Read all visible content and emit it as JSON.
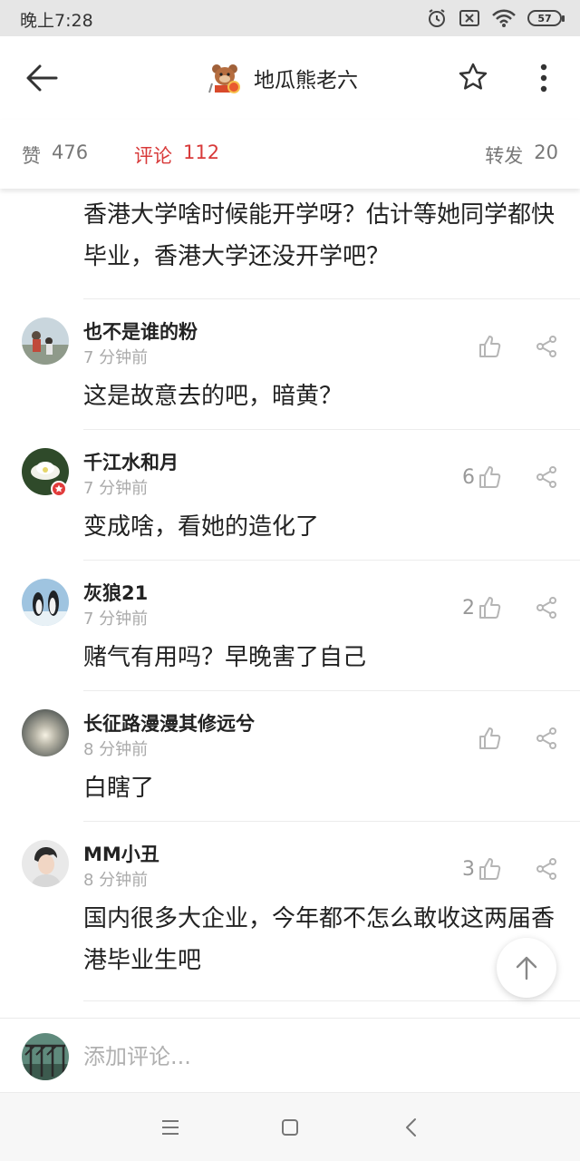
{
  "status_bar": {
    "time": "晚上7:28",
    "battery": "57"
  },
  "header": {
    "title": "地瓜熊老六"
  },
  "tabs": {
    "like_label": "赞",
    "like_count": "476",
    "comment_label": "评论",
    "comment_count": "112",
    "repost_label": "转发",
    "repost_count": "20"
  },
  "colors": {
    "accent": "#d83a3a",
    "muted": "#999999"
  },
  "partial_comment": {
    "text": "香港大学啥时候能开学呀？估计等她同学都快毕业，香港大学还没开学吧？"
  },
  "comments": [
    {
      "name": "也不是谁的粉",
      "time": "7 分钟前",
      "text": "这是故意去的吧，暗黄？",
      "likes": ""
    },
    {
      "name": "千江水和月",
      "time": "7 分钟前",
      "text": "变成啥，看她的造化了",
      "likes": "6"
    },
    {
      "name": "灰狼21",
      "time": "7 分钟前",
      "text": "赌气有用吗？早晚害了自己",
      "likes": "2"
    },
    {
      "name": "长征路漫漫其修远兮",
      "time": "8 分钟前",
      "text": "白瞎了",
      "likes": ""
    },
    {
      "name": "MM小丑",
      "time": "8 分钟前",
      "text": "国内很多大企业，今年都不怎么敢收这两届香港毕业生吧",
      "likes": "3"
    }
  ],
  "input": {
    "placeholder": "添加评论..."
  }
}
